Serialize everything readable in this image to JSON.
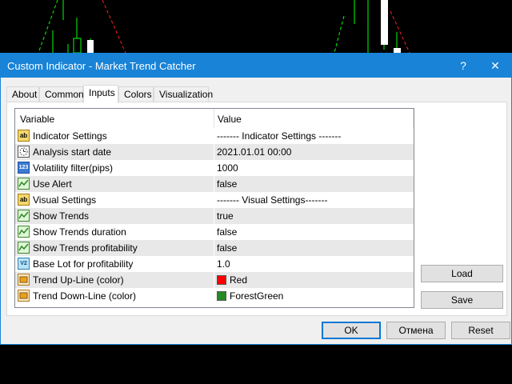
{
  "window": {
    "title": "Custom Indicator - Market Trend Catcher",
    "help_label": "?",
    "close_label": "✕"
  },
  "tabs": [
    {
      "label": "About",
      "active": false
    },
    {
      "label": "Common",
      "active": false
    },
    {
      "label": "Inputs",
      "active": true
    },
    {
      "label": "Colors",
      "active": false
    },
    {
      "label": "Visualization",
      "active": false
    }
  ],
  "grid": {
    "headers": {
      "variable": "Variable",
      "value": "Value"
    },
    "rows": [
      {
        "icon": "ab-text-icon",
        "variable": "Indicator Settings",
        "value": "------- Indicator Settings -------"
      },
      {
        "icon": "datetime-icon",
        "variable": "Analysis start date",
        "value": "2021.01.01 00:00"
      },
      {
        "icon": "integer-icon",
        "variable": "Volatility filter(pips)",
        "value": "1000"
      },
      {
        "icon": "boolean-icon",
        "variable": "Use Alert",
        "value": "false"
      },
      {
        "icon": "ab-text-icon",
        "variable": "Visual Settings",
        "value": "------- Visual Settings-------"
      },
      {
        "icon": "boolean-icon",
        "variable": "Show Trends",
        "value": "true"
      },
      {
        "icon": "boolean-icon",
        "variable": "Show Trends duration",
        "value": "false"
      },
      {
        "icon": "boolean-icon",
        "variable": "Show Trends profitability",
        "value": "false"
      },
      {
        "icon": "double-icon",
        "variable": "Base Lot for profitability",
        "value": "1.0"
      },
      {
        "icon": "color-icon",
        "variable": "Trend Up-Line (color)",
        "value": "Red",
        "swatch": "#ff0000"
      },
      {
        "icon": "color-icon",
        "variable": "Trend Down-Line (color)",
        "value": "ForestGreen",
        "swatch": "#228b22"
      }
    ]
  },
  "side_buttons": {
    "load": "Load",
    "save": "Save"
  },
  "footer_buttons": {
    "ok": "OK",
    "cancel": "Отмена",
    "reset": "Reset"
  },
  "colors": {
    "title_bar": "#1883d7",
    "chart_background": "#000000",
    "candle_up": "#00ff00",
    "candle_body": "#ffffff",
    "trend_up_line": "#ff0000",
    "trend_down_line": "#228b22"
  }
}
